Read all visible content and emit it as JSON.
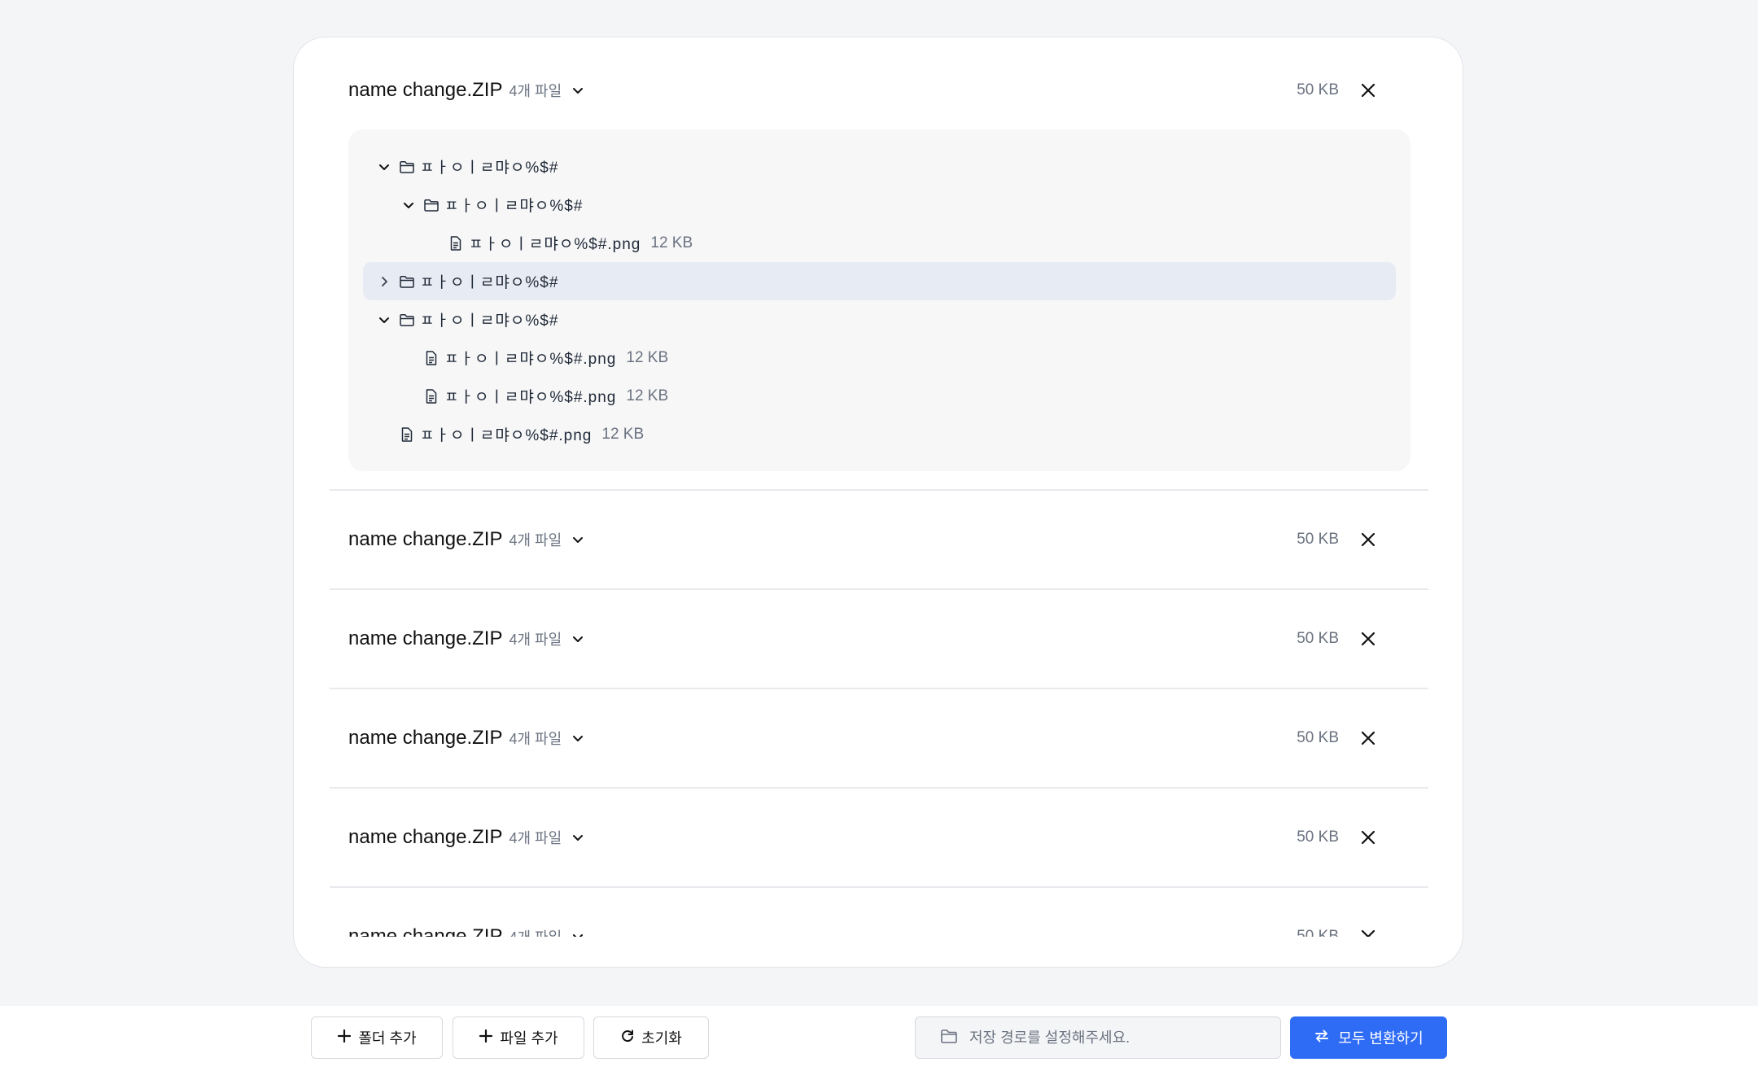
{
  "zips": [
    {
      "name": "name change.ZIP",
      "count": "4개 파일",
      "size": "50 KB",
      "expanded": true,
      "tree": [
        {
          "type": "folder",
          "depth": 0,
          "expanded": true,
          "name": "ㅍㅏㅇㅣㄹ먀ㅇ%$#"
        },
        {
          "type": "folder",
          "depth": 1,
          "expanded": true,
          "name": "ㅍㅏㅇㅣㄹ먀ㅇ%$#"
        },
        {
          "type": "file",
          "depth": 2,
          "name": "ㅍㅏㅇㅣㄹ먀ㅇ%$#.png",
          "size": "12 KB"
        },
        {
          "type": "folder",
          "depth": 0,
          "expanded": false,
          "selected": true,
          "name": "ㅍㅏㅇㅣㄹ먀ㅇ%$#"
        },
        {
          "type": "folder",
          "depth": 0,
          "expanded": true,
          "name": "ㅍㅏㅇㅣㄹ먀ㅇ%$#"
        },
        {
          "type": "file",
          "depth": 1,
          "name": "ㅍㅏㅇㅣㄹ먀ㅇ%$#.png",
          "size": "12 KB"
        },
        {
          "type": "file",
          "depth": 1,
          "name": "ㅍㅏㅇㅣㄹ먀ㅇ%$#.png",
          "size": "12 KB"
        },
        {
          "type": "file",
          "depth": 0,
          "root_file": true,
          "name": "ㅍㅏㅇㅣㄹ먀ㅇ%$#.png",
          "size": "12 KB"
        }
      ]
    },
    {
      "name": "name change.ZIP",
      "count": "4개 파일",
      "size": "50 KB",
      "expanded": false
    },
    {
      "name": "name change.ZIP",
      "count": "4개 파일",
      "size": "50 KB",
      "expanded": false
    },
    {
      "name": "name change.ZIP",
      "count": "4개 파일",
      "size": "50 KB",
      "expanded": false
    },
    {
      "name": "name change.ZIP",
      "count": "4개 파일",
      "size": "50 KB",
      "expanded": false
    },
    {
      "name": "name change.ZIP",
      "count": "4개 파일",
      "size": "50 KB",
      "expanded": false
    }
  ],
  "footer": {
    "add_folder": "폴더 추가",
    "add_file": "파일 추가",
    "reset": "초기화",
    "path_placeholder": "저장 경로를 설정해주세요.",
    "convert_all": "모두 변환하기"
  },
  "colors": {
    "accent": "#2f6cf6",
    "selected_row": "#e7ebf3"
  },
  "icons": {
    "chevron": "chevron-down-icon",
    "close": "close-icon",
    "folder": "folder-icon",
    "file": "file-icon",
    "plus": "plus-icon",
    "reset": "refresh-icon",
    "convert": "swap-arrows-icon"
  }
}
